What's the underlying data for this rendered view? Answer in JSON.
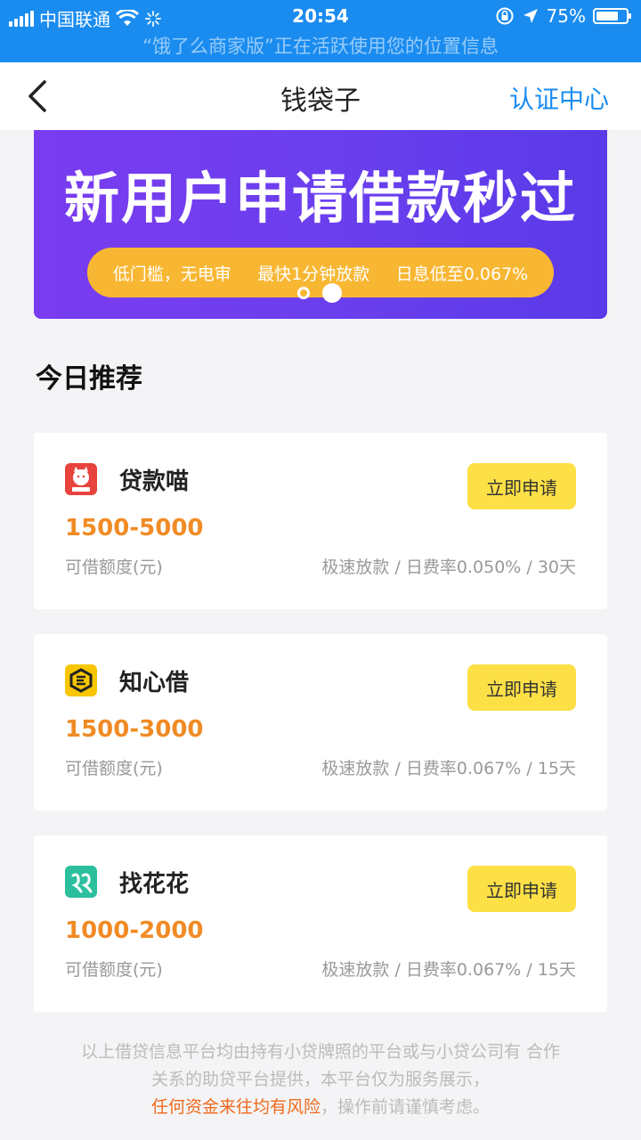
{
  "status_bar": {
    "carrier": "中国联通",
    "time": "20:54",
    "battery": "75%",
    "battery_level": 0.75,
    "location_notice": "“饿了么商家版”正在活跃使用您的位置信息"
  },
  "nav": {
    "title": "钱袋子",
    "right_action": "认证中心"
  },
  "banner": {
    "headline": "新用户申请借款秒过",
    "features": [
      "低门槛，无电审",
      "最快1分钟放款",
      "日息低至0.067%"
    ],
    "slide_count": 2,
    "active_slide": 1
  },
  "section": {
    "title": "今日推荐"
  },
  "products": [
    {
      "name": "贷款喵",
      "amount": "1500-5000",
      "amount_label": "可借额度(元)",
      "detail": "极速放款 / 日费率0.050% / 30天",
      "button": "立即申请",
      "logo_color": "#e8433d"
    },
    {
      "name": "知心借",
      "amount": "1500-3000",
      "amount_label": "可借额度(元)",
      "detail": "极速放款 / 日费率0.067% / 15天",
      "button": "立即申请",
      "logo_color": "#f7c600"
    },
    {
      "name": "找花花",
      "amount": "1000-2000",
      "amount_label": "可借额度(元)",
      "detail": "极速放款 / 日费率0.067% / 15天",
      "button": "立即申请",
      "logo_color": "#2bbf9e"
    }
  ],
  "disclaimer": {
    "line1": "以上借贷信息平台均由持有小贷牌照的平台或与小贷公司有 合作",
    "line2": "关系的助贷平台提供，本平台仅为服务展示，",
    "risk": "任何资金来往均有风险",
    "line3_tail": "，操作前请谨慎考虑。"
  },
  "colors": {
    "status_bar": "#1a8cf0",
    "accent": "#1a8cf0",
    "banner": "#6b3fee",
    "pill": "#f8b733",
    "amount": "#f08b25",
    "button": "#fde046",
    "risk": "#ee6a1e"
  }
}
